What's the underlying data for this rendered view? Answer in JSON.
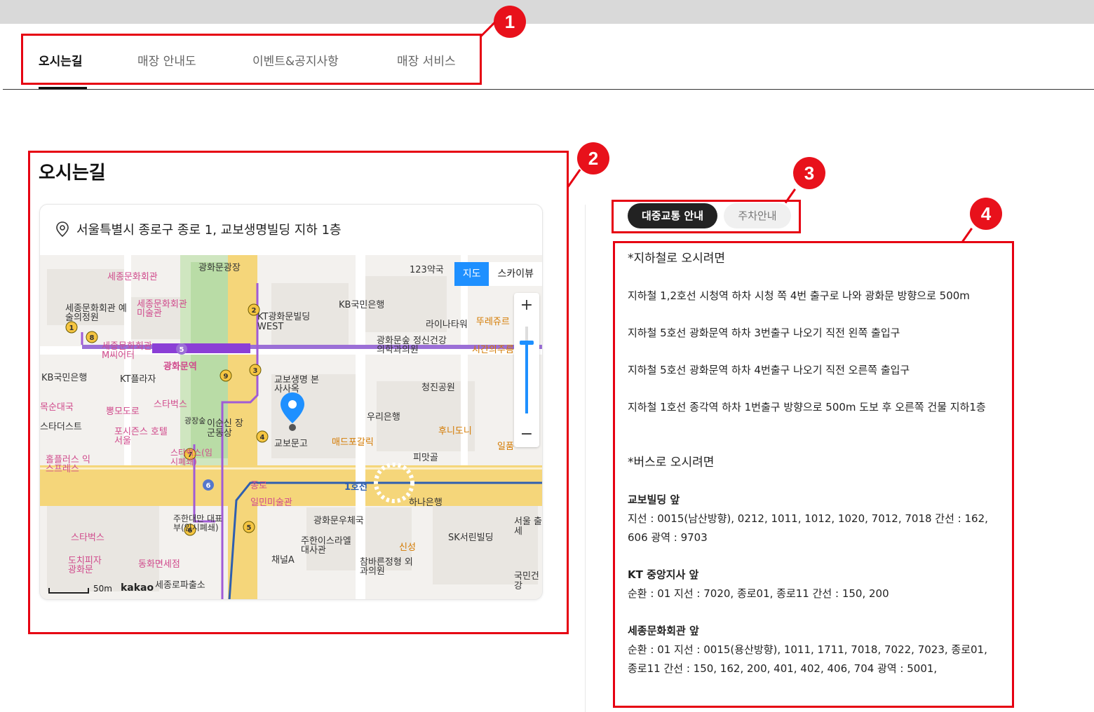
{
  "tabs": [
    {
      "label": "오시는길",
      "active": true
    },
    {
      "label": "매장 안내도",
      "active": false
    },
    {
      "label": "이벤트&공지사항",
      "active": false
    },
    {
      "label": "매장 서비스",
      "active": false
    }
  ],
  "annotations": [
    "1",
    "2",
    "3",
    "4"
  ],
  "section_title": "오시는길",
  "address": "서울특별시 종로구 종로 1, 교보생명빌딩 지하 1층",
  "map": {
    "view_options": [
      "지도",
      "스카이뷰"
    ],
    "zoom_in": "+",
    "zoom_out": "−",
    "scale": "50m",
    "provider": "kakao",
    "labels": {
      "sejong_center": "세종문화회관",
      "gwanghwamun_square": "광화문광장",
      "pharmacy": "123약국",
      "art_school": "세종문화회관 예술의정원",
      "museum": "세종문화회관 미술관",
      "kt_west": "KT광화문빌딩 WEST",
      "kb_bank": "KB국민은행",
      "lina_tower": "라이나타워",
      "tous": "뚜레쥬르",
      "mcity": "세종문화회관 M씨어터",
      "gwanghwamun_stn": "광화문역",
      "clinic": "광화문숲 정신건강의학과의원",
      "sigan": "시간의주름",
      "kb_left": "KB국민은행",
      "kt_plaza": "KT플라자",
      "cheongjin": "청진공원",
      "kyobo_hq": "교보생명 본사사옥",
      "gukbap": "목순대국",
      "ppyeong": "뽕모도로",
      "starbucks1": "스타벅스",
      "woori": "우리은행",
      "startus": "스타더스트",
      "four_seasons": "포시즌스 호텔 서울",
      "yisunsin": "이순신 장군동상",
      "gwangjang": "광장숲",
      "kyobo_books": "교보문고",
      "mcdonald": "매드포갈릭",
      "hoony": "후니도니",
      "ilpum": "일품",
      "hollys": "홀플러스 익스프레스",
      "starbucks_temp": "스타벅스(임시폐쇄)",
      "pimatgol": "피맛골",
      "jongno": "종로",
      "line1": "1호선",
      "ilmin": "일민미술관",
      "hana": "하나은행",
      "jugyung": "주한대만 대표부(임시폐쇄)",
      "post": "광화문우체국",
      "seoul_bldg": "서울 출세",
      "sk": "SK서린빌딩",
      "starbucks2": "스타벅스",
      "israel": "주한이스라엘 대사관",
      "shinsung": "신성",
      "channel_a": "채널A",
      "chambaren": "참바른정형 외과의원",
      "dochi": "도치피자 광화문",
      "dongwha": "동화면세점",
      "sejongro_police": "세종로파출소",
      "kookmin": "국민건강"
    }
  },
  "transit_tabs": [
    {
      "label": "대중교통 안내",
      "active": true
    },
    {
      "label": "주차안내",
      "active": false
    }
  ],
  "info": {
    "subway_heading": "*지하철로 오시려면",
    "subway": [
      "지하철 1,2호선 시청역 하차 시청 쪽 4번 출구로 나와 광화문 방향으로 500m",
      "지하철 5호선 광화문역 하차 3번출구 나오기 직전 왼쪽 출입구",
      "지하철 5호선 광화문역 하차 4번출구 나오기 직전 오른쪽 출입구",
      "지하철 1호선 종각역 하차 1번출구 방향으로 500m 도보 후 오른쪽 건물 지하1층"
    ],
    "bus_heading": "*버스로 오시려면",
    "bus": [
      {
        "stop": "교보빌딩 앞",
        "routes": "지선 : 0015(남산방향), 0212, 1011, 1012, 1020, 7012, 7018 간선 : 162, 606 광역 : 9703"
      },
      {
        "stop": "KT 중앙지사 앞",
        "routes": "순환 : 01 지선 : 7020, 종로01, 종로11 간선 : 150, 200"
      },
      {
        "stop": "세종문화회관 앞",
        "routes": "순환 : 01 지선 : 0015(용산방향), 1011, 1711, 7018, 7022, 7023, 종로01, 종로11 간선 : 150, 162, 200, 401, 402, 406, 704 광역 : 5001,"
      }
    ]
  },
  "colors": {
    "annotation_red": "#e60012",
    "map_blue": "#1e90ff",
    "subway_line5": "#8b3fd6",
    "road_yellow": "#f5d67a"
  }
}
